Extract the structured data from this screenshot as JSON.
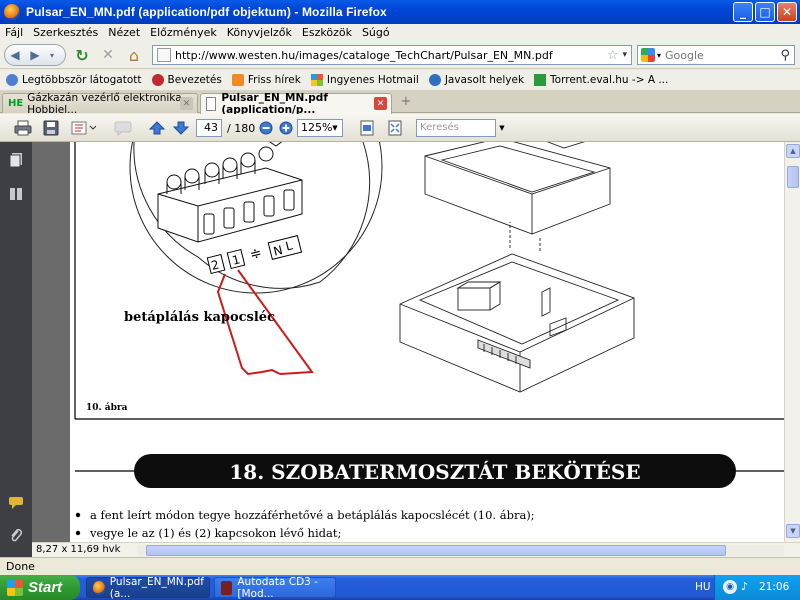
{
  "window": {
    "title": "Pulsar_EN_MN.pdf (application/pdf objektum) - Mozilla Firefox",
    "min": "_",
    "max": "□",
    "close": "✕"
  },
  "menu": [
    "Fájl",
    "Szerkesztés",
    "Nézet",
    "Előzmények",
    "Könyvjelzők",
    "Eszközök",
    "Súgó"
  ],
  "nav": {
    "back": "◀",
    "forward": "▶",
    "reload": "↻",
    "stop": "✕",
    "home": "⌂",
    "url": "http://www.westen.hu/images/cataloge_TechChart/Pulsar_EN_MN.pdf",
    "bookmark_star": "☆",
    "search_placeholder": "Google",
    "search_icon": "⚲"
  },
  "bookmarks": [
    {
      "label": "Legtöbbször látogatott",
      "icon": "firefox-icon",
      "color": "#4f7fd2"
    },
    {
      "label": "Bevezetés",
      "icon": "bug-icon",
      "color": "#c0292d"
    },
    {
      "label": "Friss hírek",
      "icon": "rss-icon",
      "color": "#f08b23"
    },
    {
      "label": "Ingyenes Hotmail",
      "icon": "windows-icon",
      "color": "#3a8de0"
    },
    {
      "label": "Javasolt helyek",
      "icon": "ie-icon",
      "color": "#2f6fc0"
    },
    {
      "label": "Torrent.eval.hu -> A ...",
      "icon": "check-icon",
      "color": "#2a9a3a"
    }
  ],
  "tabs": [
    {
      "label": "Gázkazán vezérlő elektronika - Hobbiel...",
      "favicon": "HE",
      "active": false
    },
    {
      "label": "Pulsar_EN_MN.pdf (application/p...",
      "active": true
    }
  ],
  "new_tab": "+",
  "pdf_toolbar": {
    "page": "43",
    "total": "/ 180",
    "zoom": "125%",
    "search_placeholder": "Keresés"
  },
  "document": {
    "terminal_labels": [
      "2",
      "1",
      "≑",
      "N",
      "L"
    ],
    "caption": "betáplálás kapocsléc",
    "figure_label": "10. ábra",
    "section_title": "18. SZOBATERMOSZTÁT BEKÖTÉSE",
    "bullets": [
      "a fent leírt módon tegye hozzáférhetővé a betáplálás kapocslécét (10. ábra);",
      "vegye le az (1) és (2) kapcsokon lévő hidat;"
    ]
  },
  "page_size": "8,27 x 11,69 hvk",
  "status": "Done",
  "taskbar": {
    "start": "Start",
    "tasks": [
      {
        "label": "Pulsar_EN_MN.pdf (a..."
      },
      {
        "label": "Autodata CD3 - [Mod..."
      }
    ],
    "lang": "HU",
    "clock": "21:06"
  },
  "colors": {
    "titlebar": "#0046d5",
    "taskbar": "#245edb",
    "start": "#2f9a30",
    "wire": "#d01a1a",
    "section_bg": "#0c0c0c"
  }
}
